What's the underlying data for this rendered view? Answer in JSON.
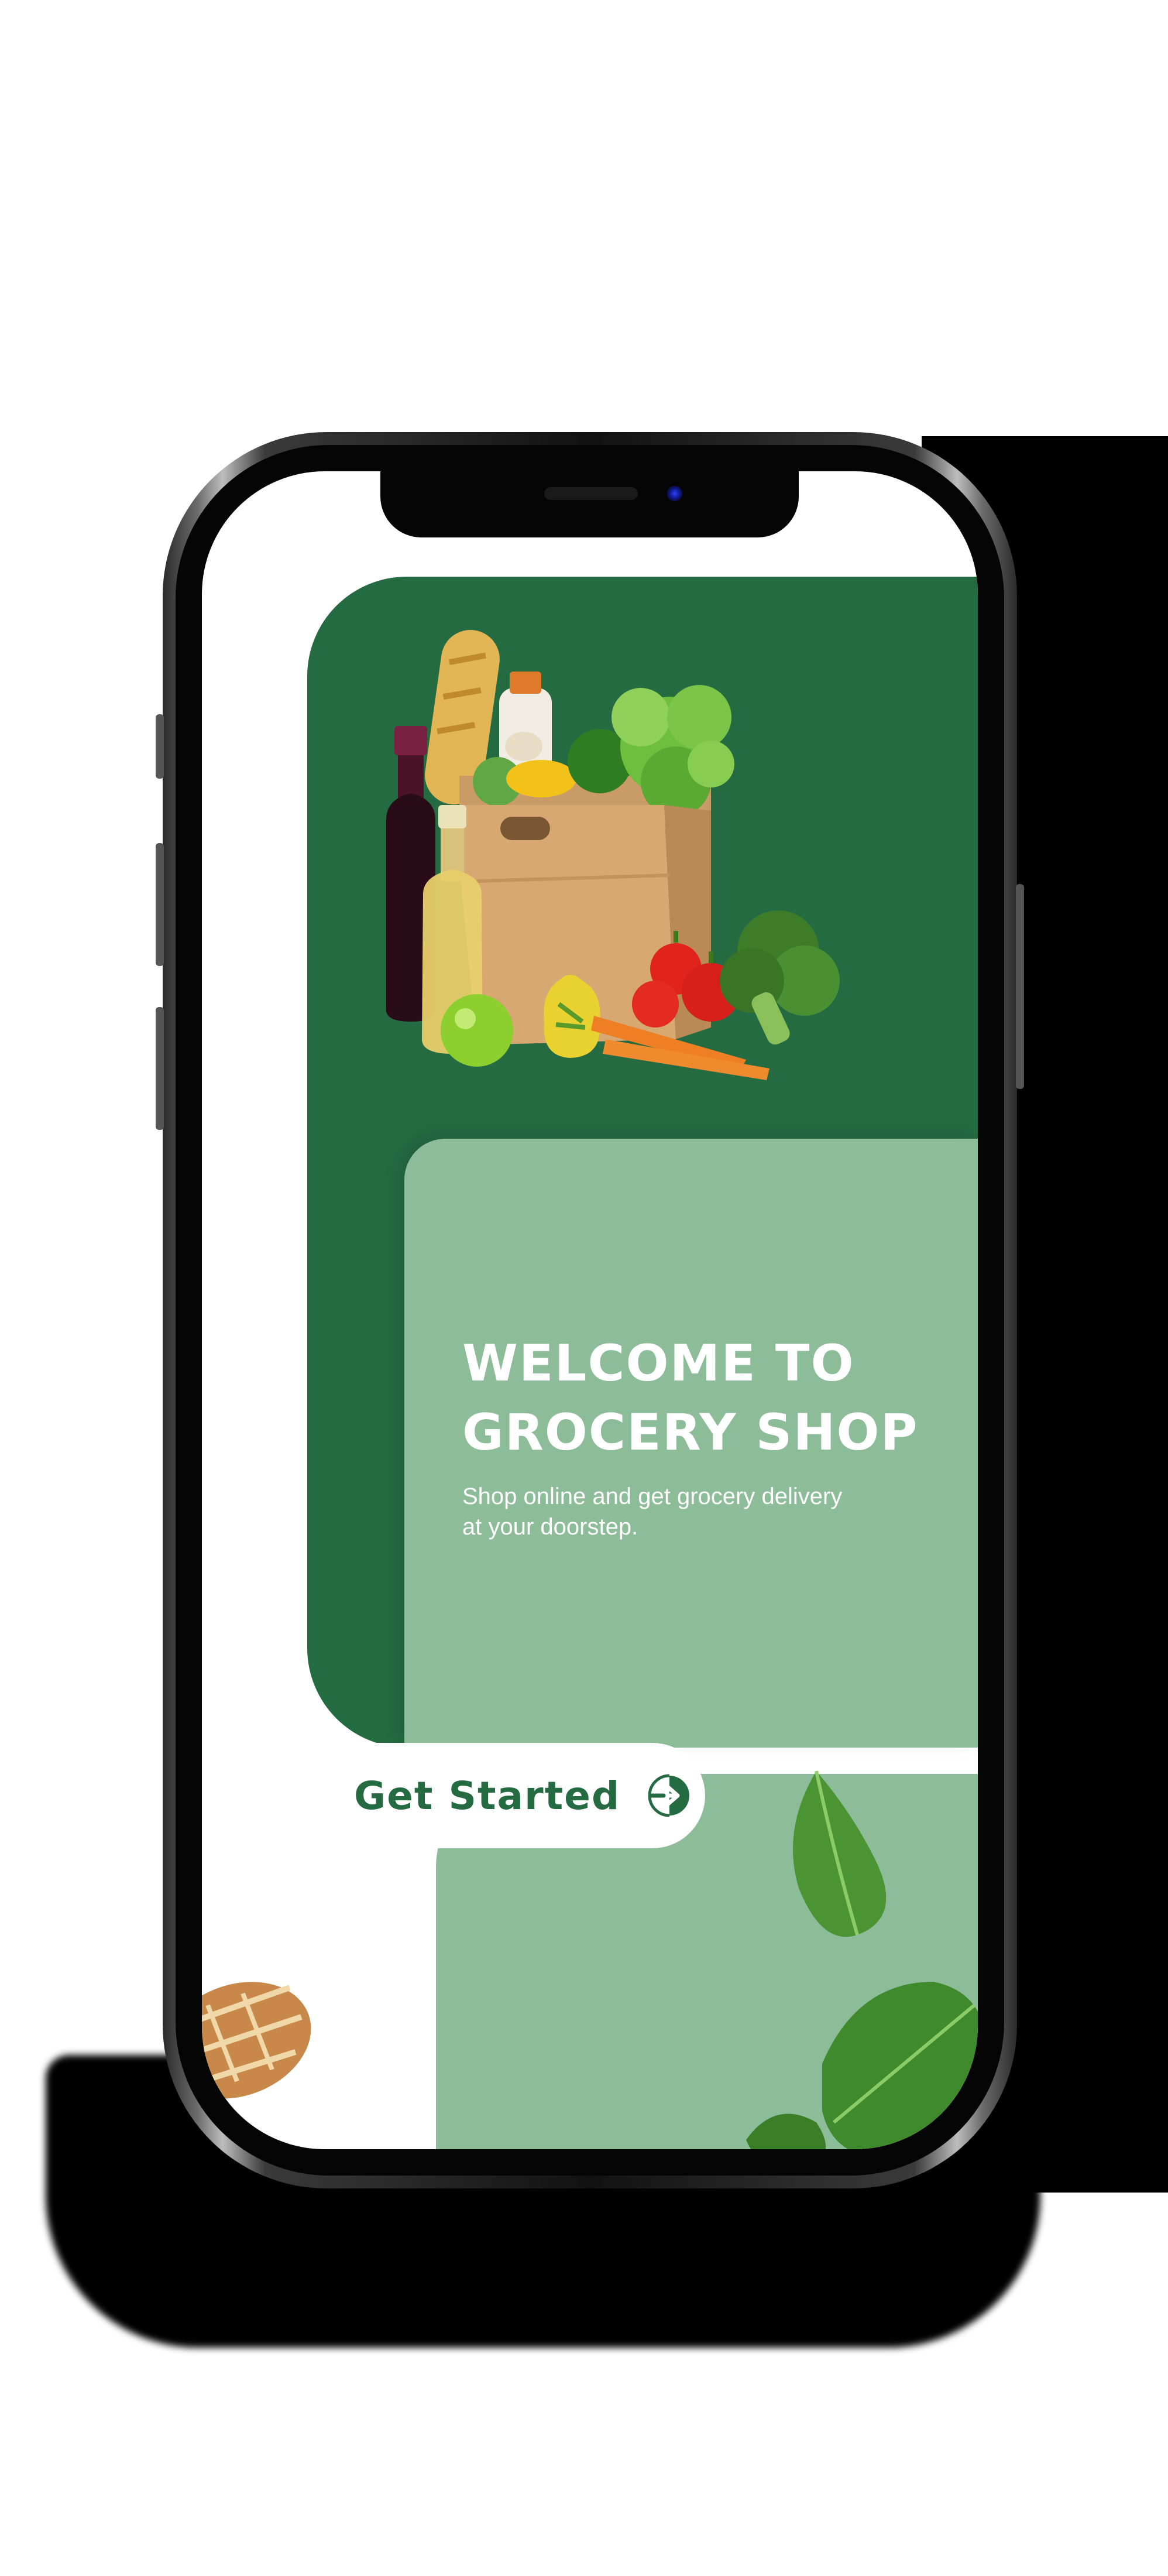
{
  "welcome": {
    "title_line1": "WELCOME TO",
    "title_line2": "GROCERY SHOP",
    "subtitle_line1": "Shop online and get grocery delivery",
    "subtitle_line2": "at your doorstep."
  },
  "cta": {
    "label": "Get Started",
    "icon": "arrow-right-circle-icon"
  },
  "colors": {
    "primary_green": "#256b42",
    "light_green": "#8cbc98",
    "white": "#ffffff"
  }
}
